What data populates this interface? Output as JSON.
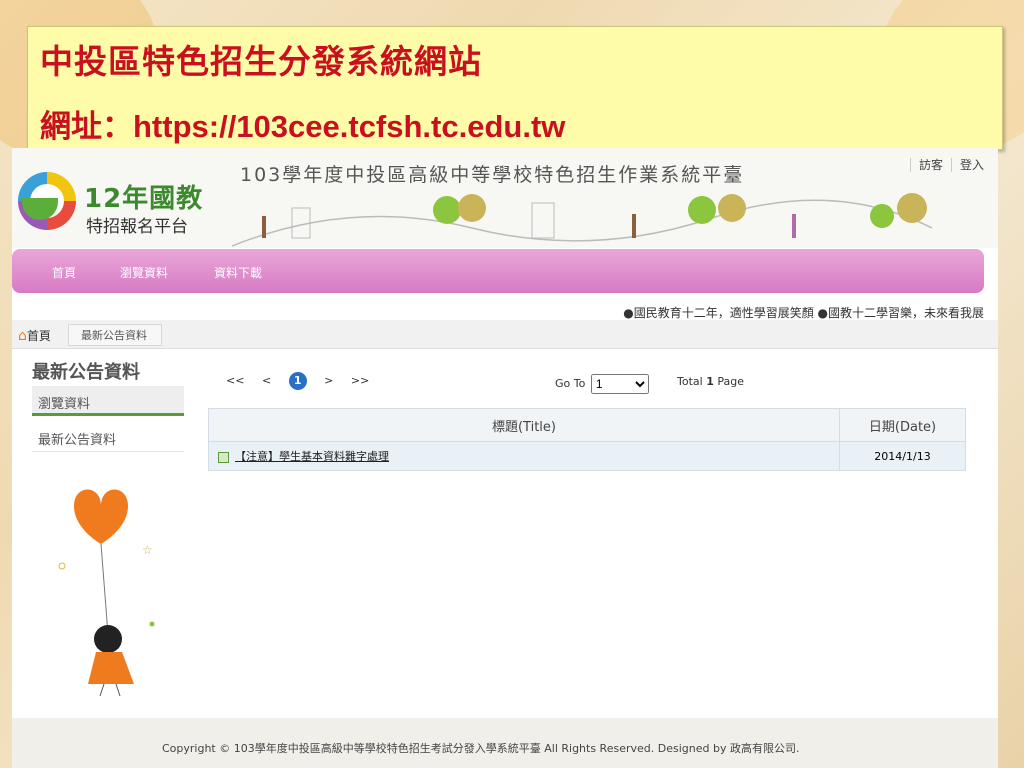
{
  "slide": {
    "title": "中投區特色招生分發系統網站",
    "url_label": "網址：",
    "url": "https://103cee.tcfsh.tc.edu.tw"
  },
  "header": {
    "logo_title": "12年國教",
    "logo_subtitle": "特招報名平台",
    "site_title": "103學年度中投區高級中等學校特色招生作業系統平臺",
    "links": [
      "訪客",
      "登入"
    ]
  },
  "nav": {
    "items": [
      "首頁",
      "瀏覽資料",
      "資料下載"
    ]
  },
  "marquee": "●國民教育十二年，適性學習展笑顏 ●國教十二學習樂，未來看我展",
  "breadcrumb": {
    "home": "首頁",
    "current": "最新公告資料"
  },
  "sidebar": {
    "title": "最新公告資料",
    "items": [
      "瀏覽資料",
      "最新公告資料"
    ]
  },
  "pager": {
    "first": "<<",
    "prev": "<",
    "current": "1",
    "next": ">",
    "last": ">>",
    "goto_label": "Go To",
    "goto_value": "1",
    "total_prefix": "Total",
    "total_pages": "1",
    "total_suffix": "Page"
  },
  "table": {
    "headers": [
      "標題(Title)",
      "日期(Date)"
    ],
    "rows": [
      {
        "title": "【注意】學生基本資料難字處理",
        "date": "2014/1/13"
      }
    ]
  },
  "footer": {
    "text": "Copyright © 103學年度中投區高級中等學校特色招生考試分發入學系統平臺 All Rights Reserved. Designed by 政高有限公司."
  }
}
